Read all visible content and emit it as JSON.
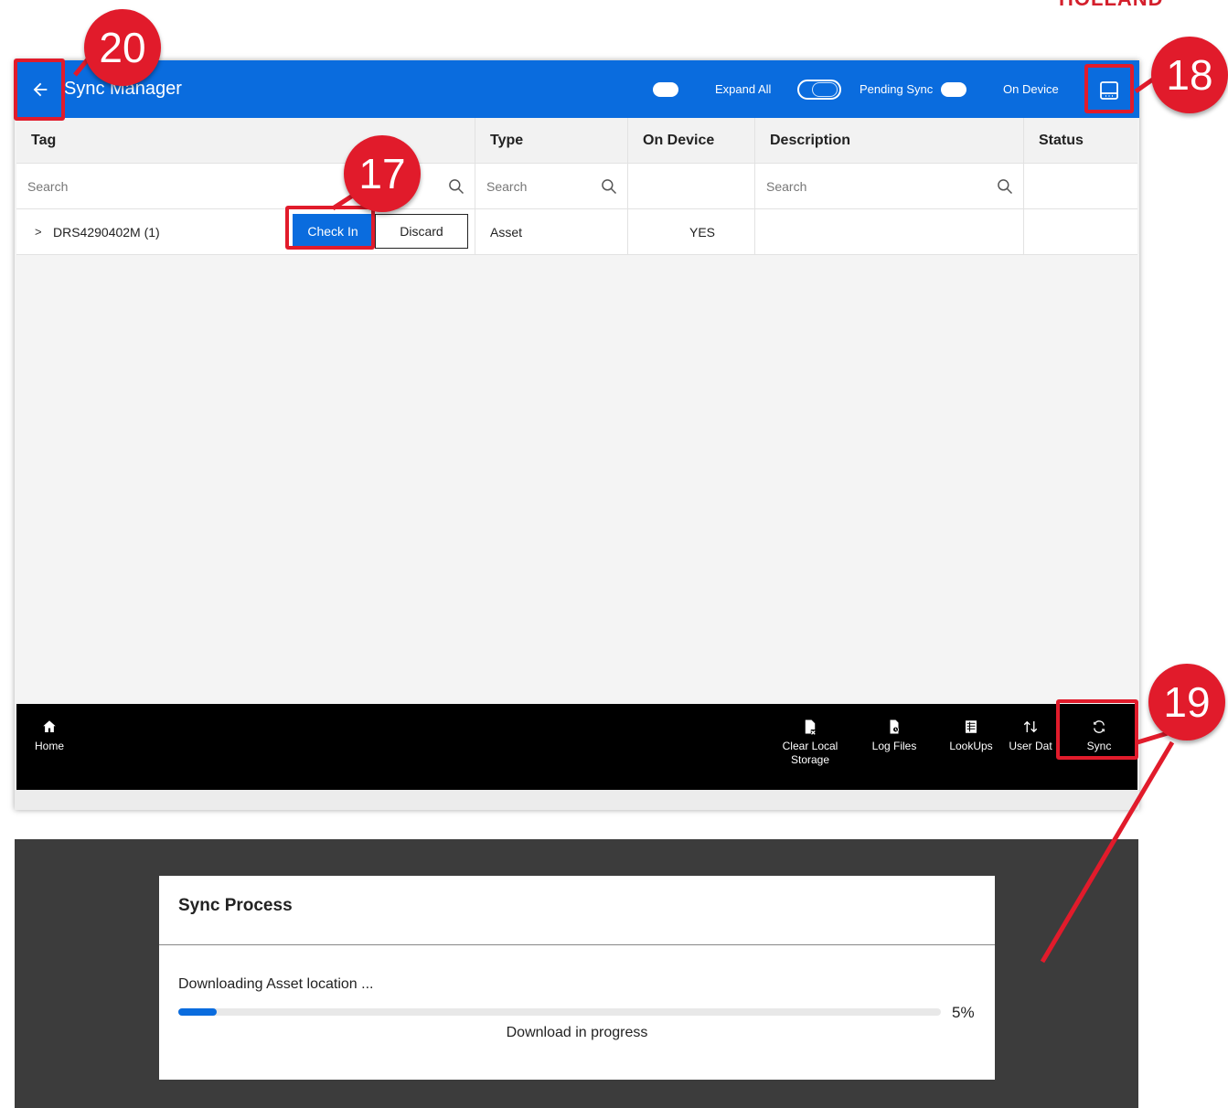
{
  "brand": "HOLLAND",
  "header": {
    "title": "Sync Manager",
    "toggles": [
      {
        "label": "Expand All",
        "state": "off"
      },
      {
        "label": "Pending Sync",
        "state": "on"
      },
      {
        "label": "On Device",
        "state": "off"
      }
    ]
  },
  "table": {
    "columns": [
      "Tag",
      "Type",
      "On Device",
      "Description",
      "Status"
    ],
    "search_placeholder": "Search",
    "rows": [
      {
        "tag": "DRS4290402M (1)",
        "type": "Asset",
        "on_device": "YES",
        "description": "",
        "status": ""
      }
    ],
    "check_in_label": "Check In",
    "discard_label": "Discard"
  },
  "bottom_nav": {
    "home": "Home",
    "clear_local_storage": "Clear Local Storage",
    "log_files": "Log Files",
    "lookups": "LookUps",
    "user_data": "User Dat",
    "sync": "Sync"
  },
  "sync_dialog": {
    "title": "Sync Process",
    "message": "Downloading Asset location ...",
    "progress_percent": 5,
    "progress_label": "5%",
    "status": "Download in progress"
  },
  "callouts": [
    "17",
    "18",
    "19",
    "20"
  ],
  "colors": {
    "accent_blue": "#0a6cde",
    "callout_red": "#e11b2b",
    "nav_black": "#000000",
    "overlay_gray": "#3c3c3c"
  },
  "icons": {
    "back": "arrow-left-icon",
    "layout": "layout-panel-icon",
    "search": "search-icon",
    "home": "home-icon",
    "clear": "clear-storage-icon",
    "log": "log-files-icon",
    "lookups": "table-icon",
    "user_data": "up-down-arrows-icon",
    "sync": "sync-icon"
  }
}
